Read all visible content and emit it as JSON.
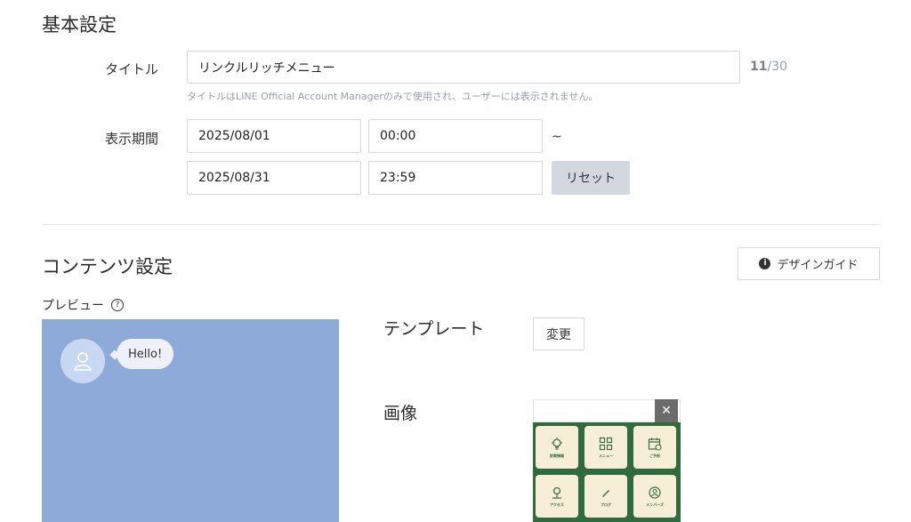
{
  "basic": {
    "heading": "基本設定",
    "title_label": "タイトル",
    "title_value": "リンクルリッチメニュー",
    "char_count": "11",
    "char_max": "/30",
    "title_hint": "タイトルはLINE Official Account Managerのみで使用され、ユーザーには表示されません。",
    "period_label": "表示期間",
    "start_date": "2025/08/01",
    "start_time": "00:00",
    "tilde": "~",
    "end_date": "2025/08/31",
    "end_time": "23:59",
    "reset_label": "リセット"
  },
  "content": {
    "heading": "コンテンツ設定",
    "design_guide_label": "デザインガイド",
    "preview_label": "プレビュー",
    "bubble_text": "Hello!",
    "template_label": "テンプレート",
    "template_change_label": "変更",
    "image_label": "画像",
    "close_symbol": "✕",
    "menu_items": [
      {
        "icon": "lightbulb-icon",
        "caption": "診察情報"
      },
      {
        "icon": "grid-icon",
        "caption": "メニュー"
      },
      {
        "icon": "calendar-icon",
        "caption": "ご予約"
      },
      {
        "icon": "map-pin-icon",
        "caption": "アクセス"
      },
      {
        "icon": "pencil-icon",
        "caption": "ブログ"
      },
      {
        "icon": "member-icon",
        "caption": "メンバーズ"
      }
    ]
  },
  "colors": {
    "preview_bg": "#8eaad9",
    "menu_green": "#2f6b3c",
    "menu_tile": "#f6efd6",
    "reset_bg": "#d3d8de"
  }
}
